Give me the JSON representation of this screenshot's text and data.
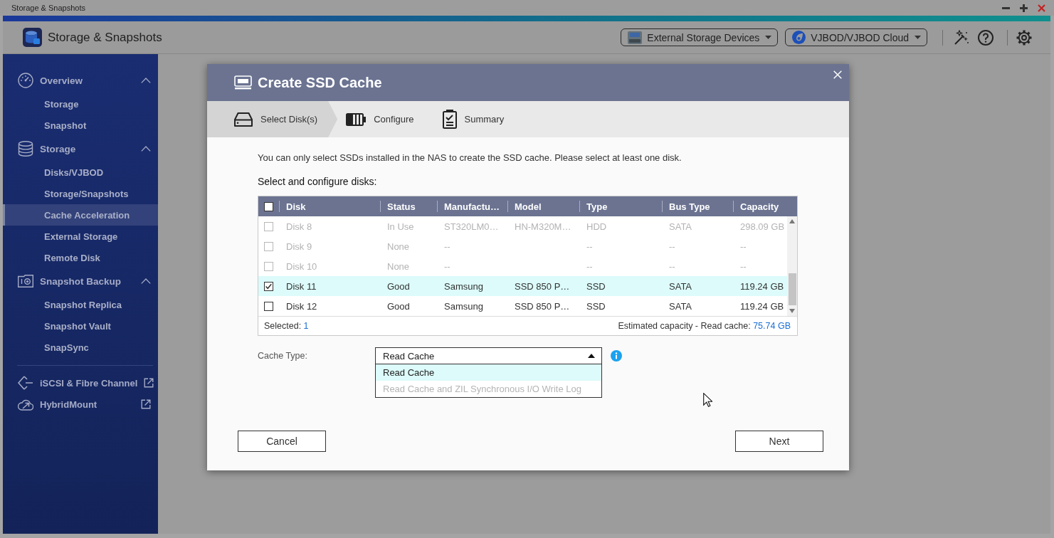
{
  "title_bar": {
    "title": "Storage & Snapshots"
  },
  "app_header": {
    "title": "Storage & Snapshots",
    "dropdowns": [
      {
        "label": "External Storage Devices",
        "kind": "drive"
      },
      {
        "label": "VJBOD/VJBOD Cloud",
        "kind": "swirl"
      }
    ]
  },
  "sidebar": {
    "sections": [
      {
        "label": "Overview",
        "kind": "gauge",
        "expanded": true,
        "children": [
          {
            "label": "Storage",
            "selected": false
          },
          {
            "label": "Snapshot",
            "selected": false
          }
        ]
      },
      {
        "label": "Storage",
        "kind": "database",
        "expanded": true,
        "children": [
          {
            "label": "Disks/VJBOD",
            "selected": false
          },
          {
            "label": "Storage/Snapshots",
            "selected": false
          },
          {
            "label": "Cache Acceleration",
            "selected": true
          },
          {
            "label": "External Storage",
            "selected": false
          },
          {
            "label": "Remote Disk",
            "selected": false
          }
        ]
      },
      {
        "label": "Snapshot Backup",
        "kind": "camera",
        "expanded": true,
        "children": [
          {
            "label": "Snapshot Replica",
            "selected": false
          },
          {
            "label": "Snapshot Vault",
            "selected": false
          },
          {
            "label": "SnapSync",
            "selected": false
          }
        ]
      }
    ],
    "links": [
      {
        "label": "iSCSI & Fibre Channel",
        "kind": "connector"
      },
      {
        "label": "HybridMount",
        "kind": "cloud"
      }
    ]
  },
  "dialog": {
    "title": "Create SSD Cache",
    "steps": [
      {
        "label": "Select Disk(s)",
        "kind": "disk",
        "selected": true
      },
      {
        "label": "Configure",
        "kind": "configure",
        "selected": false
      },
      {
        "label": "Summary",
        "kind": "checklist",
        "selected": false
      }
    ],
    "intro": "You can only select SSDs installed in the NAS to create the SSD cache. Please select at least one disk.",
    "table_title": "Select and configure disks:",
    "table": {
      "select_all_checked": false,
      "columns": [
        "Disk",
        "Status",
        "Manufactu…",
        "Model",
        "Type",
        "Bus Type",
        "Capacity"
      ],
      "rows": [
        {
          "disk": "Disk 8",
          "status": "In Use",
          "manufacturer": "ST320LM0…",
          "model": "HN-M320M…",
          "type": "HDD",
          "bus_type": "SATA",
          "capacity": "298.09 GB",
          "selected": false,
          "disabled": true
        },
        {
          "disk": "Disk 9",
          "status": "None",
          "manufacturer": "--",
          "type": "--",
          "bus_type": "--",
          "capacity": "--",
          "selected": false,
          "disabled": true
        },
        {
          "disk": "Disk 10",
          "status": "None",
          "manufacturer": "--",
          "type": "--",
          "bus_type": "--",
          "capacity": "--",
          "selected": false,
          "disabled": true
        },
        {
          "disk": "Disk 11",
          "status": "Good",
          "manufacturer": "Samsung",
          "model": "SSD 850 P…",
          "type": "SSD",
          "bus_type": "SATA",
          "capacity": "119.24 GB",
          "selected": true,
          "disabled": false
        },
        {
          "disk": "Disk 12",
          "status": "Good",
          "manufacturer": "Samsung",
          "model": "SSD 850 P…",
          "type": "SSD",
          "bus_type": "SATA",
          "capacity": "119.24 GB",
          "selected": false,
          "disabled": false
        }
      ],
      "footer": {
        "selected_label": "Selected:",
        "selected_count": "1",
        "estimate_label": "Estimated capacity - Read cache:",
        "estimate_value": "75.74 GB"
      }
    },
    "cache_type": {
      "label": "Cache Type:",
      "value": "Read Cache",
      "expanded": true,
      "options": [
        {
          "label": "Read Cache",
          "selected": true,
          "disabled": false
        },
        {
          "label": "Read Cache and ZIL Synchronous I/O Write Log",
          "selected": false,
          "disabled": true
        }
      ]
    },
    "buttons": [
      {
        "label": "Cancel"
      },
      {
        "label": "Next"
      }
    ]
  }
}
